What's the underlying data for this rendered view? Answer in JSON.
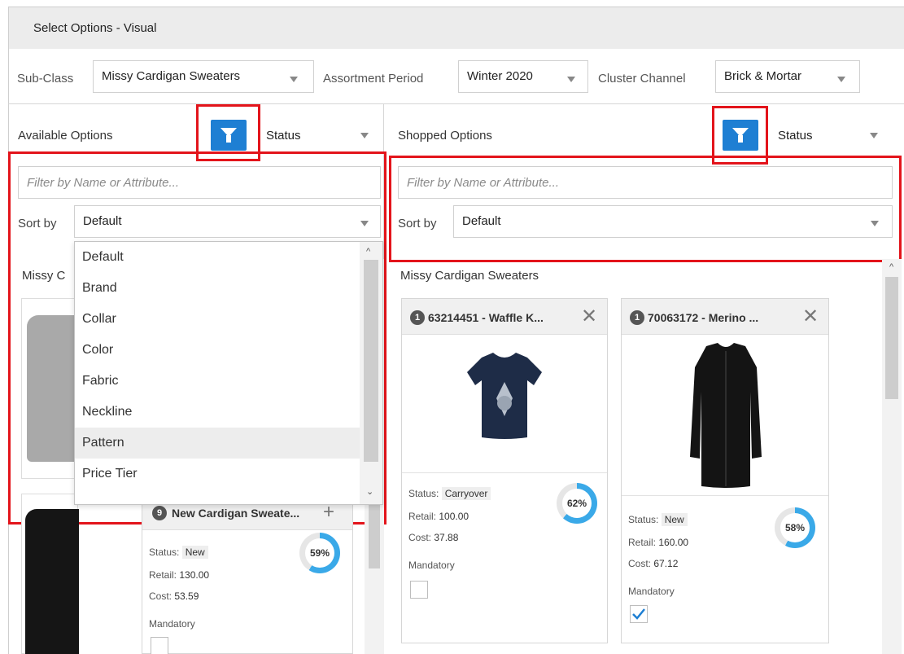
{
  "window": {
    "title": "Select Options - Visual"
  },
  "selectors": {
    "subclass": {
      "label": "Sub-Class",
      "value": "Missy Cardigan Sweaters"
    },
    "assortment_period": {
      "label": "Assortment Period",
      "value": "Winter 2020"
    },
    "cluster_channel": {
      "label": "Cluster Channel",
      "value": "Brick & Mortar"
    }
  },
  "available": {
    "title": "Available Options",
    "status_label": "Status",
    "filter_placeholder": "Filter by Name or Attribute...",
    "sort_label": "Sort by",
    "sort_value": "Default",
    "group_title_partial": "Missy C",
    "sort_options": [
      "Default",
      "Brand",
      "Collar",
      "Color",
      "Fabric",
      "Neckline",
      "Pattern",
      "Price Tier"
    ],
    "sort_options_hovered": "Pattern",
    "card": {
      "count": "9",
      "title": "New Cardigan Sweate...",
      "status_label": "Status:",
      "status": "New",
      "retail_label": "Retail:",
      "retail": "130.00",
      "cost_label": "Cost:",
      "cost": "53.59",
      "mandatory_label": "Mandatory",
      "percent_text": "59%",
      "percent": 59
    }
  },
  "shopped": {
    "title": "Shopped Options",
    "status_label": "Status",
    "filter_placeholder": "Filter by Name or Attribute...",
    "sort_label": "Sort by",
    "sort_value": "Default",
    "group_title": "Missy Cardigan Sweaters",
    "cards": [
      {
        "count": "1",
        "title": "63214451 - Waffle K...",
        "status_label": "Status:",
        "status": "Carryover",
        "retail_label": "Retail:",
        "retail": "100.00",
        "cost_label": "Cost:",
        "cost": "37.88",
        "mandatory_label": "Mandatory",
        "mandatory": false,
        "percent_text": "62%",
        "percent": 62
      },
      {
        "count": "1",
        "title": "70063172 - Merino ...",
        "status_label": "Status:",
        "status": "New",
        "retail_label": "Retail:",
        "retail": "160.00",
        "cost_label": "Cost:",
        "cost": "67.12",
        "mandatory_label": "Mandatory",
        "mandatory": true,
        "percent_text": "58%",
        "percent": 58
      }
    ]
  },
  "colors": {
    "accent": "#1e7fd3",
    "highlight": "#e3141b",
    "donut": "#3aa9e8",
    "donut_track": "#e6e6e6"
  }
}
